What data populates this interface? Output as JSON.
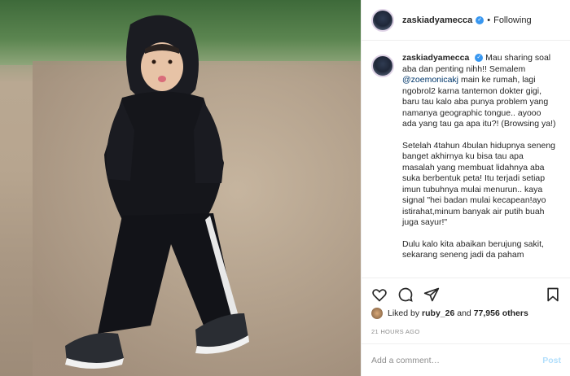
{
  "header": {
    "username": "zaskiadyamecca",
    "dot": "•",
    "follow_label": "Following"
  },
  "caption": {
    "username": "zaskiadyamecca",
    "p1_a": "Mau sharing soal aba dan penting nihh!! Semalem",
    "p1_mention": "@zoemonicakj",
    "p1_b": "main ke rumah, lagi ngobrol2 karna tantemon dokter gigi, baru tau kalo aba punya problem yang namanya geographic tongue.. ayooo ada yang tau ga apa itu?! (Browsing ya!)",
    "p2": "Setelah 4tahun 4bulan hidupnya seneng banget akhirnya ku bisa tau apa masalah yang membuat lidahnya aba suka berbentuk peta! Itu terjadi setiap imun tubuhnya mulai menurun.. kaya signal \"hei badan mulai kecapean!ayo istirahat,minum banyak air putih buah juga sayur!\"",
    "p3": "Dulu kalo kita abaikan berujung sakit, sekarang seneng jadi da paham"
  },
  "likes": {
    "prefix": "Liked by",
    "user": "ruby_26",
    "mid": "and",
    "count": "77,956 others"
  },
  "timestamp": "21 HOURS AGO",
  "comment": {
    "placeholder": "Add a comment…",
    "post_label": "Post"
  },
  "colors": {
    "verified": "#3897f0",
    "post_disabled": "#b2dffc"
  },
  "icons": [
    "heart-icon",
    "comment-icon",
    "share-icon",
    "bookmark-icon",
    "verified-icon"
  ]
}
